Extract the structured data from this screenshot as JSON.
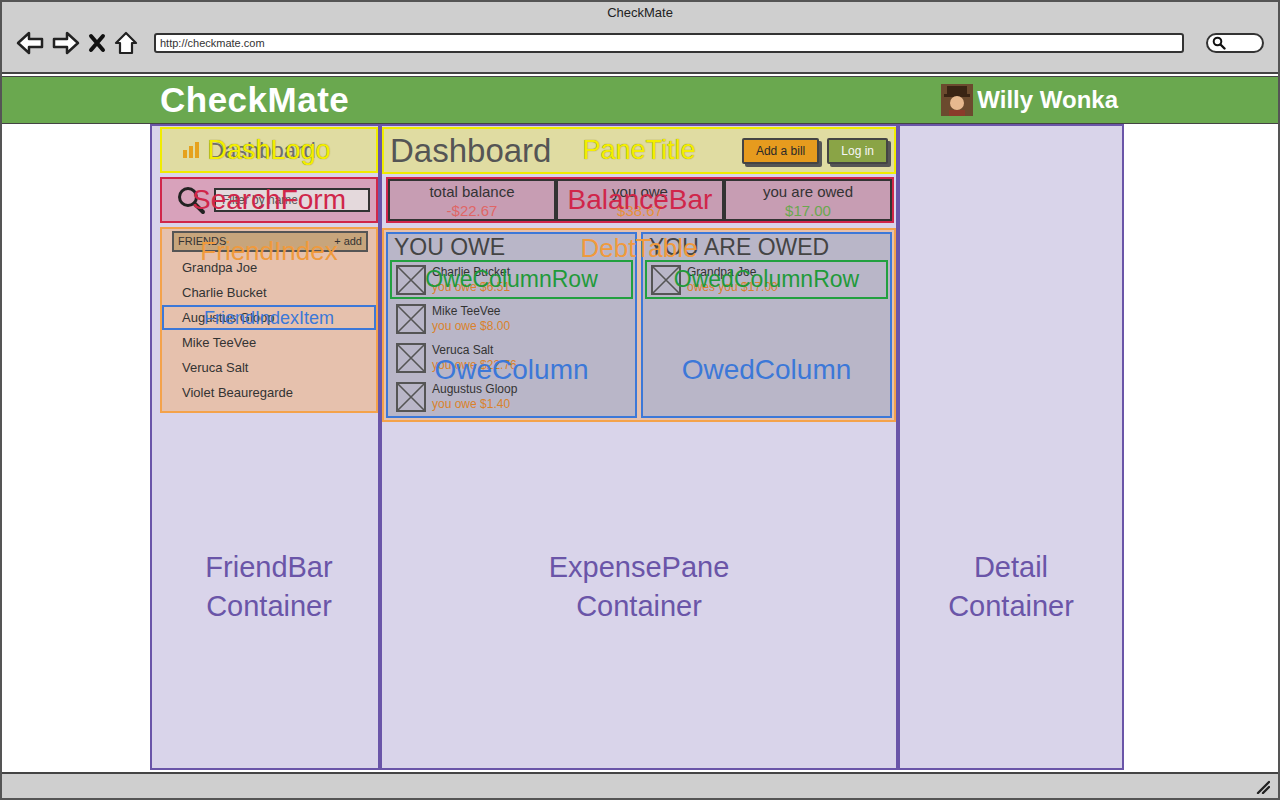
{
  "window": {
    "title": "CheckMate",
    "url": "http://checkmate.com"
  },
  "app": {
    "logo": "CheckMate",
    "user": "Willy Wonka"
  },
  "friend_bar": {
    "container_label": [
      "FriendBar",
      "Container"
    ],
    "dash_logo": {
      "text": "Dashboard",
      "annotation": "DashLogo"
    },
    "search": {
      "placeholder": "Filter by name",
      "annotation": "SearchForm"
    },
    "friend_index": {
      "header": "FRIENDS",
      "add": "+ add",
      "annotation": "FriendIndex",
      "item_annotation": "FriendIndexItem",
      "friends": [
        {
          "name": "Grandpa Joe",
          "annotated": false
        },
        {
          "name": "Charlie Bucket",
          "annotated": false
        },
        {
          "name": "Augustus Gloop",
          "annotated": true
        },
        {
          "name": "Mike TeeVee",
          "annotated": false
        },
        {
          "name": "Veruca Salt",
          "annotated": false
        },
        {
          "name": "Violet Beauregarde",
          "annotated": false
        }
      ]
    }
  },
  "expense_pane": {
    "container_label": [
      "ExpensePane",
      "Container"
    ],
    "title": {
      "text": "Dashboard",
      "annotation": "PaneTitle",
      "buttons": [
        {
          "label": "Add a bill",
          "kind": "primary"
        },
        {
          "label": "Log in",
          "kind": "secondary"
        }
      ]
    },
    "balance": {
      "annotation": "BalanceBar",
      "cells": [
        {
          "label": "total balance",
          "amount": "-$22.67",
          "color": "#e06666"
        },
        {
          "label": "you owe",
          "amount": "$38.67",
          "color": "#e69138"
        },
        {
          "label": "you are owed",
          "amount": "$17.00",
          "color": "#6aa84f"
        }
      ]
    },
    "debt_table": {
      "annotation": "DebtTable",
      "columns": [
        {
          "header": "YOU OWE",
          "annotation": "OweColumn",
          "row_annotation": "OweColumnRow",
          "rows": [
            {
              "name": "Charlie Bucket",
              "amount": "you owe $6.51",
              "annotated": true
            },
            {
              "name": "Mike TeeVee",
              "amount": "you owe $8.00",
              "annotated": false
            },
            {
              "name": "Veruca Salt",
              "amount": "you owe $22.76",
              "annotated": false
            },
            {
              "name": "Augustus Gloop",
              "amount": "you owe $1.40",
              "annotated": false
            }
          ]
        },
        {
          "header": "YOU ARE OWED",
          "annotation": "OwedColumn",
          "row_annotation": "OwedColumnRow",
          "rows": [
            {
              "name": "Grandpa Joe",
              "amount": "owes you $17.00",
              "annotated": true
            }
          ]
        }
      ]
    }
  },
  "detail": {
    "container_label": [
      "Detail",
      "Container"
    ]
  }
}
